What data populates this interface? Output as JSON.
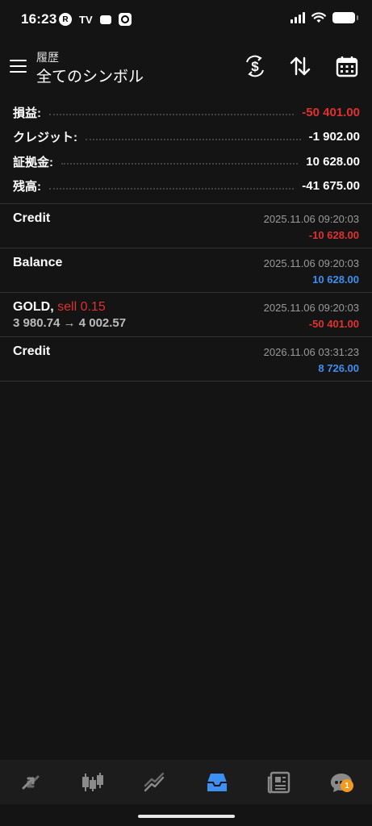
{
  "status_bar": {
    "time": "16:23",
    "left_icons": [
      "r-app-icon",
      "tradingview-icon",
      "wallet-icon",
      "camera-icon"
    ],
    "right_icons": [
      "cellular-signal-icon",
      "wifi-icon",
      "battery-icon"
    ]
  },
  "header": {
    "subtitle": "履歴",
    "title": "全てのシンボル",
    "icons": [
      "menu-icon",
      "currency-exchange-icon",
      "sort-icon",
      "calendar-icon"
    ]
  },
  "summary": [
    {
      "label": "損益:",
      "value": "-50 401.00",
      "color": "red"
    },
    {
      "label": "クレジット:",
      "value": "-1 902.00",
      "color": "white"
    },
    {
      "label": "証拠金:",
      "value": "10 628.00",
      "color": "white"
    },
    {
      "label": "残高:",
      "value": "-41 675.00",
      "color": "white"
    }
  ],
  "deals": [
    {
      "name": "Credit",
      "side": "",
      "price": "",
      "date": "2025.11.06 09:20:03",
      "amount": "-10 628.00",
      "color": "red"
    },
    {
      "name": "Balance",
      "side": "",
      "price": "",
      "date": "2025.11.06 09:20:03",
      "amount": "10 628.00",
      "color": "blue"
    },
    {
      "name": "GOLD,",
      "side": "sell 0.15",
      "price": "3 980.74 → 4 002.57",
      "date": "2025.11.06 09:20:03",
      "amount": "-50 401.00",
      "color": "red"
    },
    {
      "name": "Credit",
      "side": "",
      "price": "",
      "date": "2026.11.06 03:31:23",
      "amount": "8 726.00",
      "color": "blue"
    }
  ],
  "bottom_nav": {
    "items": [
      "quotes-icon",
      "chart-icon",
      "trade-icon",
      "history-icon",
      "news-icon",
      "chat-icon"
    ],
    "active": "history-icon",
    "chat_badge": "1"
  },
  "colors": {
    "red": "#e0312f",
    "blue": "#3d8ff1",
    "active": "#3d8ff1",
    "inactive": "#8a8a8a"
  }
}
